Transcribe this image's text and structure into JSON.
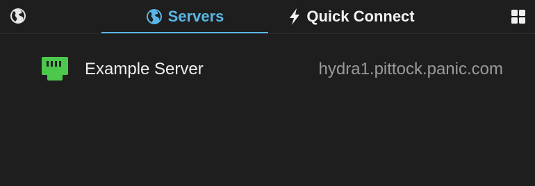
{
  "toolbar": {
    "left_icon": "globe-icon",
    "right_icon": "grid-icon"
  },
  "tabs": [
    {
      "label": "Servers",
      "icon": "globe-icon",
      "active": true
    },
    {
      "label": "Quick Connect",
      "icon": "lightning-icon",
      "active": false
    }
  ],
  "servers": [
    {
      "name": "Example Server",
      "host": "hydra1.pittock.panic.com",
      "icon": "ethernet-port-icon"
    }
  ],
  "colors": {
    "background": "#1e1e1e",
    "accent": "#5ab6e6",
    "server_icon": "#4cc94c",
    "host_text": "#9a9a9a"
  }
}
